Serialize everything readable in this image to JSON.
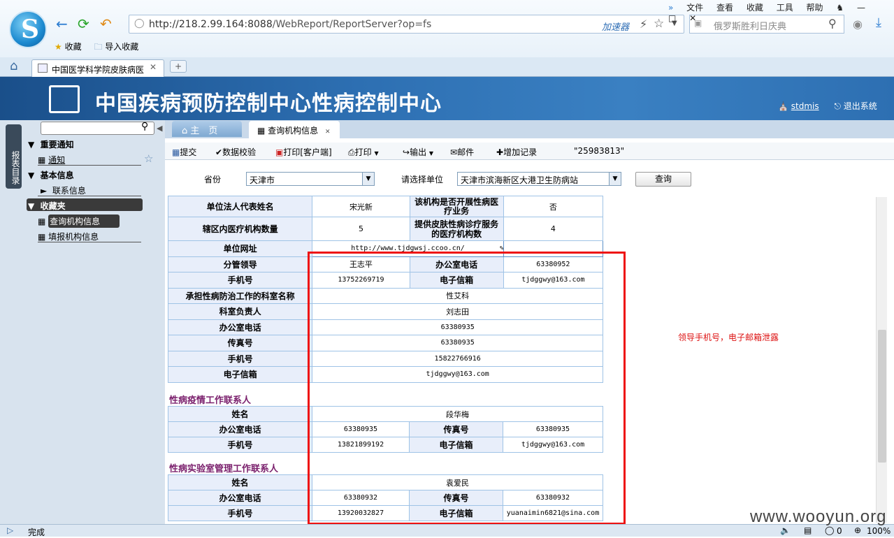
{
  "browser": {
    "menu": [
      "文件",
      "查看",
      "收藏",
      "工具",
      "帮助"
    ],
    "url_host": "http://218.2.99.164:8088",
    "url_path": "/WebReport/ReportServer?op=fs",
    "accelerator": "加速器",
    "search_placeholder": "俄罗斯胜利日庆典",
    "fav_label": "收藏",
    "import_fav_label": "导入收藏",
    "tab_title": "中国医学科学院皮肤病医",
    "status": "完成",
    "zoom": "100%",
    "status_count": "0"
  },
  "header": {
    "title": "中国疾病预防控制中心性病控制中心",
    "user": "stdmis",
    "logout": "退出系统"
  },
  "sidebar": {
    "strip_label": "报表目录",
    "groups": [
      {
        "label": "重要通知",
        "items": [
          "通知"
        ]
      },
      {
        "label": "基本信息",
        "items": [
          "联系信息"
        ]
      },
      {
        "label": "收藏夹",
        "items": [
          "查询机构信息",
          "填报机构信息"
        ]
      }
    ]
  },
  "tabs": {
    "home": "主　页",
    "current": "查询机构信息"
  },
  "toolbar": {
    "submit": "提交",
    "validate": "数据校验",
    "print_client": "打印[客户端]",
    "print": "打印",
    "export": "输出",
    "mail": "邮件",
    "add_record": "增加记录",
    "record_id": "\"25983813\""
  },
  "query": {
    "province_label": "省份",
    "province_value": "天津市",
    "unit_label": "请选择单位",
    "unit_value": "天津市滨海新区大港卫生防病站",
    "query_button": "查询"
  },
  "form": {
    "legal_rep_label": "单位法人代表姓名",
    "legal_rep": "宋光新",
    "std_service_label": "该机构是否开展性病医疗业务",
    "std_service": "否",
    "district_count_label": "辖区内医疗机构数量",
    "district_count": "5",
    "skin_service_label": "提供皮肤性病诊疗服务的医疗机构数",
    "skin_service": "4",
    "website_label": "单位网址",
    "website": "http://www.tjdgwsj.ccoo.cn/",
    "leader_label": "分管领导",
    "leader": "王志平",
    "office_phone_label": "办公室电话",
    "leader_office_phone": "63380952",
    "mobile_label": "手机号",
    "leader_mobile": "13752269719",
    "email_label": "电子信箱",
    "leader_email": "tjdggwy@163.com",
    "dept_label": "承担性病防治工作的科室名称",
    "dept": "性艾科",
    "dept_head_label": "科室负责人",
    "dept_head": "刘志田",
    "dept_office_phone": "63380935",
    "fax_label": "传真号",
    "dept_fax": "63380935",
    "dept_mobile": "15822766916",
    "dept_email": "tjdggwy@163.com",
    "section2": "性病疫情工作联系人",
    "name_label": "姓名",
    "epi_name": "段华梅",
    "epi_office_phone": "63380935",
    "epi_fax": "63380935",
    "epi_mobile": "13821899192",
    "epi_email": "tjdggwy@163.com",
    "section3": "性病实验室管理工作联系人",
    "lab_name": "袁爱民",
    "lab_office_phone": "63380932",
    "lab_fax": "63380932",
    "lab_mobile": "13920032827",
    "lab_email": "yuanaimin6821@sina.com"
  },
  "annotation": {
    "note": "领导手机号，电子邮箱泄露",
    "color": "#dd1111"
  },
  "watermark": "www.wooyun.org"
}
